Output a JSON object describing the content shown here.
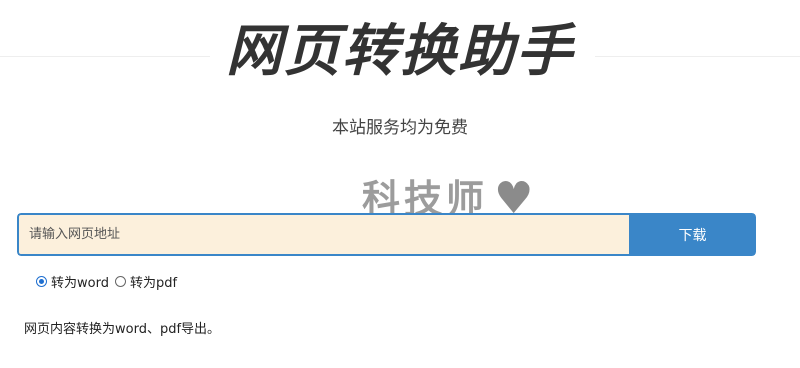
{
  "header": {
    "title": "网页转换助手",
    "subtitle": "本站服务均为免费"
  },
  "watermark": {
    "name": "科技师",
    "url": "https://www.3kjs.com"
  },
  "form": {
    "url_placeholder": "请输入网页地址",
    "download_label": "下载",
    "options": [
      {
        "label": "转为word",
        "selected": true
      },
      {
        "label": "转为pdf",
        "selected": false
      }
    ]
  },
  "description": "网页内容转换为word、pdf导出。",
  "colors": {
    "accent": "#3a86c8",
    "input_background": "#fcf0dc"
  }
}
